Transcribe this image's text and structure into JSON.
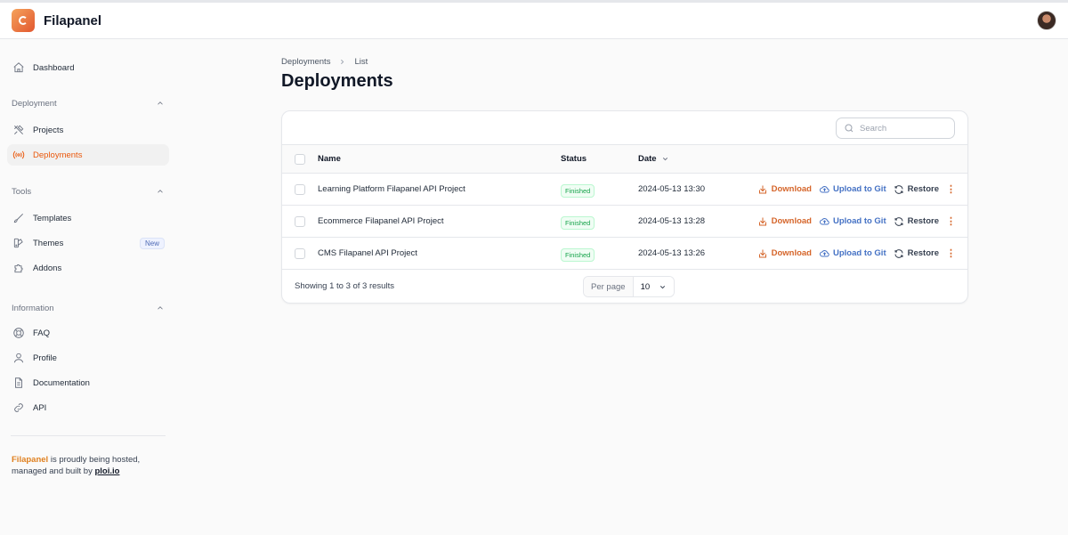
{
  "app": {
    "name": "Filapanel"
  },
  "sidebar": {
    "dashboard": "Dashboard",
    "groups": [
      {
        "label": "Deployment",
        "items": [
          {
            "label": "Projects"
          },
          {
            "label": "Deployments"
          }
        ]
      },
      {
        "label": "Tools",
        "items": [
          {
            "label": "Templates"
          },
          {
            "label": "Themes",
            "badge": "New"
          },
          {
            "label": "Addons"
          }
        ]
      },
      {
        "label": "Information",
        "items": [
          {
            "label": "FAQ"
          },
          {
            "label": "Profile"
          },
          {
            "label": "Documentation"
          },
          {
            "label": "API"
          }
        ]
      }
    ],
    "hosted": {
      "brand": "Filapanel",
      "text1": " is proudly being hosted,",
      "text2": "managed and built by ",
      "link": "ploi.io"
    }
  },
  "breadcrumb": {
    "parent": "Deployments",
    "current": "List"
  },
  "page_title": "Deployments",
  "search": {
    "placeholder": "Search"
  },
  "table": {
    "headers": {
      "name": "Name",
      "status": "Status",
      "date": "Date"
    },
    "rows": [
      {
        "name": "Learning Platform Filapanel API Project",
        "status": "Finished",
        "date": "2024-05-13 13:30"
      },
      {
        "name": "Ecommerce Filapanel API Project",
        "status": "Finished",
        "date": "2024-05-13 13:28"
      },
      {
        "name": "CMS Filapanel API Project",
        "status": "Finished",
        "date": "2024-05-13 13:26"
      }
    ],
    "actions": {
      "download": "Download",
      "upload": "Upload to Git",
      "restore": "Restore"
    }
  },
  "pagination": {
    "showing": "Showing 1 to 3 of 3 results",
    "per_page_label": "Per page",
    "per_page_value": "10"
  },
  "colors": {
    "accent": "#ea580c",
    "link_blue": "#4471c4",
    "success": "#16a34a"
  }
}
